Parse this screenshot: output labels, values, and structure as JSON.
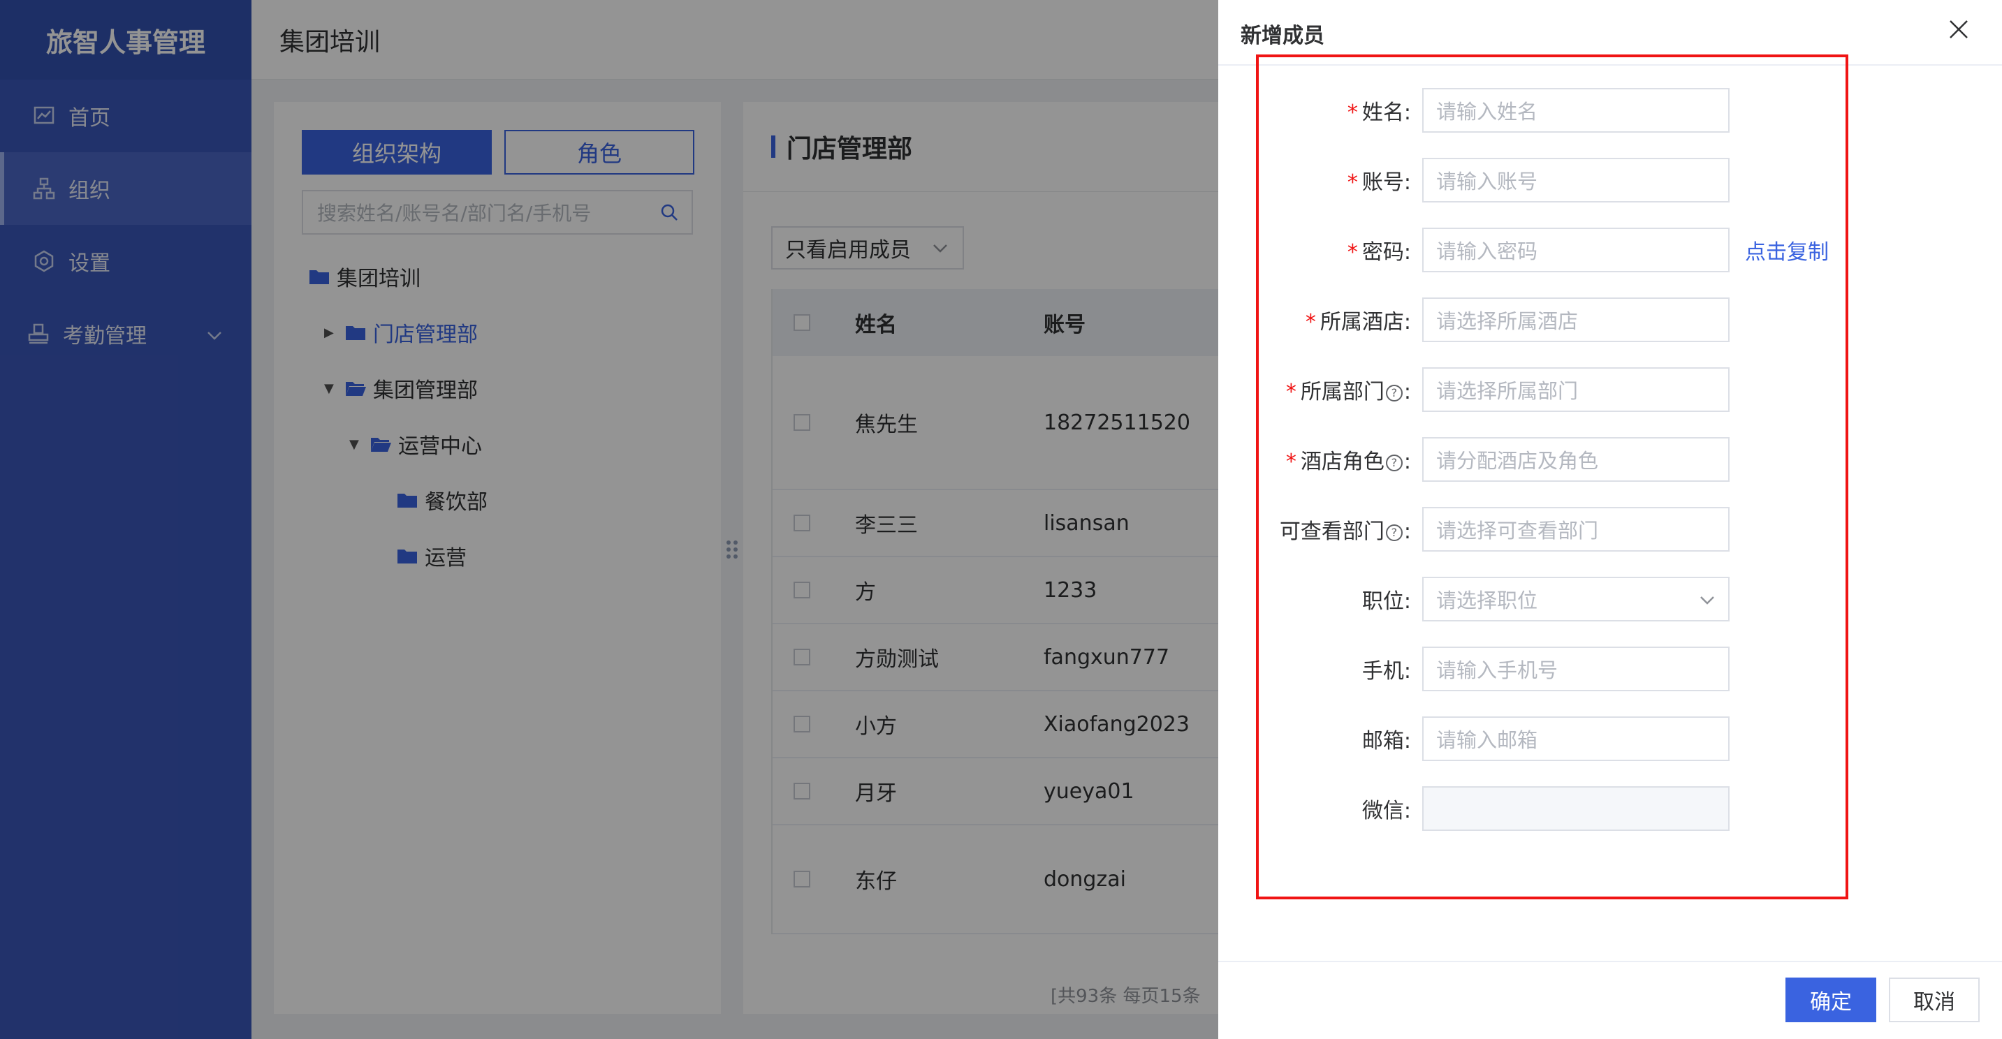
{
  "sidebar": {
    "brand": "旅智人事管理",
    "items": [
      {
        "label": "首页"
      },
      {
        "label": "组织"
      },
      {
        "label": "设置"
      },
      {
        "label": "考勤管理"
      }
    ]
  },
  "header": {
    "title": "集团培训"
  },
  "left_panel": {
    "tabs": [
      "组织架构",
      "角色"
    ],
    "search_placeholder": "搜索姓名/账号名/部门名/手机号",
    "tree": [
      "集团培训",
      "门店管理部",
      "集团管理部",
      "运营中心",
      "餐饮部",
      "运营"
    ]
  },
  "right_panel": {
    "title": "门店管理部",
    "filter": "只看启用成员",
    "columns": [
      "姓名",
      "账号"
    ],
    "rows": [
      {
        "name": "焦先生",
        "account": "18272511520"
      },
      {
        "name": "李三三",
        "account": "lisansan"
      },
      {
        "name": "方",
        "account": "1233"
      },
      {
        "name": "方勋测试",
        "account": "fangxun777"
      },
      {
        "name": "小方",
        "account": "Xiaofang2023"
      },
      {
        "name": "月牙",
        "account": "yueya01"
      },
      {
        "name": "东仔",
        "account": "dongzai"
      }
    ],
    "pager_text": "[共93条 每页15条 "
  },
  "drawer": {
    "title": "新增成员",
    "fields": [
      {
        "label": "姓名:",
        "placeholder": "请输入姓名"
      },
      {
        "label": "账号:",
        "placeholder": "请输入账号"
      },
      {
        "label": "密码:",
        "placeholder": "请输入密码"
      },
      {
        "label": "所属酒店:",
        "placeholder": "请选择所属酒店"
      },
      {
        "label": "所属部门",
        "placeholder": "请选择所属部门"
      },
      {
        "label": "酒店角色",
        "placeholder": "请分配酒店及角色"
      },
      {
        "label": "可查看部门",
        "placeholder": "请选择可查看部门"
      },
      {
        "label": "职位:",
        "placeholder": "请选择职位"
      },
      {
        "label": "手机:",
        "placeholder": "请输入手机号"
      },
      {
        "label": "邮箱:",
        "placeholder": "请输入邮箱"
      },
      {
        "label": "微信:",
        "placeholder": ""
      }
    ],
    "copy_link": "点击复制",
    "confirm": "确定",
    "cancel": "取消"
  },
  "colors": {
    "primary": "#3a63e0",
    "sidebar": "#3a57b8",
    "required": "#f01414",
    "highlight_frame": "#f01414"
  }
}
